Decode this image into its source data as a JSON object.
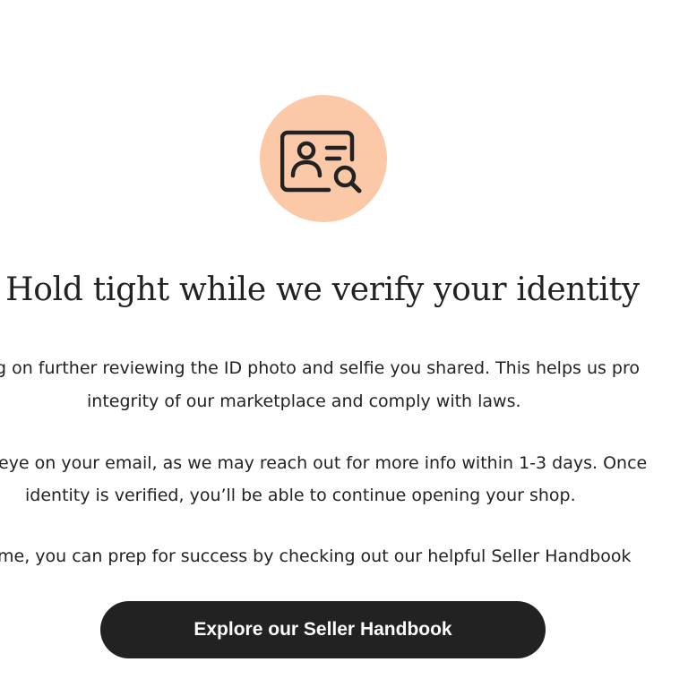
{
  "icon": {
    "name": "id-card-search-icon",
    "badge_color": "#fbc9a7"
  },
  "title": "Hold tight while we verify your identity",
  "paragraphs": {
    "p1_line1": "g on further reviewing the ID photo and selfie you shared. This helps us pro",
    "p1_line2": "integrity of our marketplace and comply with laws.",
    "p2_line1": "eye on your email, as we may reach out for more info within 1-3 days. Once",
    "p2_line2": "identity is verified, you’ll be able to continue opening your shop.",
    "p3_line1": "me, you can prep for success by checking out our helpful Seller Handbook"
  },
  "cta": {
    "label": "Explore our Seller Handbook",
    "color": "#222222"
  }
}
